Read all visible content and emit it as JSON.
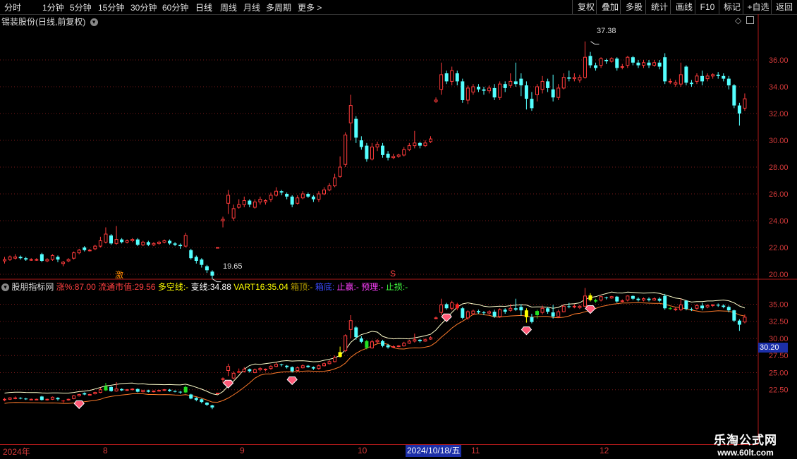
{
  "toolbar": {
    "periods": [
      "分时",
      "1分钟",
      "5分钟",
      "15分钟",
      "30分钟",
      "60分钟",
      "日线",
      "周线",
      "月线",
      "多周期",
      "更多 >"
    ],
    "active_period": "日线",
    "actions": [
      "复权",
      "叠加",
      "多股",
      "统计",
      "画线",
      "F10",
      "标记",
      "+自选",
      "返回"
    ]
  },
  "main_chart": {
    "title": "锡装股份(日线,前复权)",
    "y_ticks": [
      "36.00",
      "34.00",
      "32.00",
      "30.00",
      "28.00",
      "26.00",
      "24.00",
      "22.00",
      "20.00"
    ],
    "high_label": "37.38",
    "low_label": "19.65",
    "marker_ji": "激",
    "marker_s": "S"
  },
  "sub_chart": {
    "indicator_name": "股朋指标网",
    "zhangfu_label": "涨%:",
    "zhangfu_value": "87.00",
    "liutong_label": "流通市值:",
    "liutong_value": "29.56",
    "duokong_label": "多空线:",
    "duokong_value": "-",
    "bianxian_label": "变线:",
    "bianxian_value": "34.88",
    "vart_label": "VART16:",
    "vart_value": "35.04",
    "xiangding_label": "箱顶:",
    "xiangding_value": "-",
    "xiangdi_label": "箱底:",
    "xiangdi_value": "",
    "zhiying_label": "止赢:",
    "zhiying_value": "-",
    "yuli_label": "预理:",
    "yuli_value": "-",
    "zhisun_label": "止损:",
    "zhisun_value": "-",
    "y_ticks": [
      "35.00",
      "32.50",
      "30.00",
      "27.50",
      "25.00",
      "22.50"
    ],
    "current_price": "30.20"
  },
  "x_axis": {
    "labels": [
      "2024年",
      "8",
      "9",
      "10",
      "11",
      "12"
    ],
    "selected_date": "2024/10/18/五"
  },
  "watermark": {
    "title": "乐淘公式网",
    "url": "www.60lt.com"
  },
  "colors": {
    "up": "#ff3b3b",
    "down": "#54ffff",
    "ma_white": "#ffffcc",
    "ma_orange": "#ff7a2a",
    "grid": "#7a1a1a",
    "axis_text": "#d63a3a"
  },
  "chart_data": {
    "type": "candlestick",
    "price_axis_range": [
      19.2,
      37.6
    ],
    "candles": [
      [
        21.0,
        21.1,
        21.3,
        20.8
      ],
      [
        21.1,
        21.3,
        21.4,
        21.0
      ],
      [
        21.2,
        21.3,
        21.5,
        21.1
      ],
      [
        21.3,
        21.2,
        21.4,
        21.1
      ],
      [
        21.2,
        21.1,
        21.3,
        21.0
      ],
      [
        21.1,
        21.1,
        21.2,
        21.0
      ],
      [
        21.1,
        21.1,
        21.2,
        21.0
      ],
      [
        21.5,
        21.0,
        21.6,
        20.9
      ],
      [
        21.0,
        21.1,
        21.2,
        20.9
      ],
      [
        21.1,
        21.4,
        21.5,
        21.0
      ],
      [
        21.3,
        21.1,
        21.4,
        20.9
      ],
      [
        20.8,
        20.9,
        21.0,
        20.6
      ],
      [
        21.0,
        21.1,
        21.2,
        20.9
      ],
      [
        21.2,
        21.6,
        21.7,
        21.1
      ],
      [
        21.6,
        21.8,
        21.9,
        21.5
      ],
      [
        22.0,
        21.8,
        22.1,
        21.7
      ],
      [
        21.8,
        21.8,
        21.9,
        21.7
      ],
      [
        21.9,
        22.1,
        22.2,
        21.8
      ],
      [
        22.1,
        22.5,
        22.8,
        22.0
      ],
      [
        22.4,
        23.0,
        23.5,
        22.3
      ],
      [
        22.9,
        22.3,
        23.0,
        22.2
      ],
      [
        22.3,
        22.6,
        23.6,
        22.2
      ],
      [
        22.6,
        22.4,
        22.7,
        22.3
      ],
      [
        22.4,
        22.5,
        22.6,
        22.3
      ],
      [
        22.5,
        22.6,
        22.7,
        22.4
      ],
      [
        22.6,
        22.2,
        22.7,
        22.1
      ],
      [
        22.2,
        22.4,
        22.5,
        22.1
      ],
      [
        22.4,
        22.2,
        22.5,
        22.1
      ],
      [
        22.2,
        22.3,
        22.4,
        22.1
      ],
      [
        22.3,
        22.4,
        22.5,
        22.2
      ],
      [
        22.4,
        22.5,
        22.6,
        22.3
      ],
      [
        22.5,
        22.3,
        22.6,
        22.2
      ],
      [
        22.3,
        22.2,
        22.4,
        22.1
      ],
      [
        22.2,
        22.1,
        22.3,
        21.9
      ],
      [
        22.1,
        22.9,
        23.1,
        22.0
      ],
      [
        21.8,
        21.2,
        21.9,
        21.1
      ],
      [
        21.3,
        21.0,
        21.4,
        20.8
      ],
      [
        21.1,
        20.7,
        21.2,
        20.5
      ],
      [
        20.6,
        20.3,
        20.7,
        20.1
      ],
      [
        20.2,
        19.9,
        20.3,
        19.65
      ],
      [
        22.0,
        22.0,
        22.0,
        22.0
      ],
      [
        24.0,
        24.1,
        24.3,
        23.5
      ],
      [
        25.3,
        25.9,
        26.3,
        24.5
      ],
      [
        24.2,
        24.9,
        25.2,
        24.0
      ],
      [
        25.0,
        25.2,
        25.6,
        24.9
      ],
      [
        25.2,
        25.5,
        25.8,
        25.0
      ],
      [
        25.5,
        25.2,
        25.6,
        25.0
      ],
      [
        25.0,
        25.4,
        25.6,
        24.9
      ],
      [
        25.4,
        25.6,
        25.8,
        25.2
      ],
      [
        25.4,
        25.5,
        25.6,
        25.2
      ],
      [
        25.6,
        25.9,
        26.1,
        25.4
      ],
      [
        25.9,
        26.2,
        26.5,
        25.8
      ],
      [
        26.2,
        26.1,
        26.3,
        25.9
      ],
      [
        26.0,
        25.8,
        26.1,
        25.6
      ],
      [
        25.8,
        25.2,
        25.9,
        25.0
      ],
      [
        25.3,
        25.7,
        25.9,
        25.2
      ],
      [
        25.7,
        26.0,
        26.2,
        25.6
      ],
      [
        26.0,
        25.8,
        26.1,
        25.7
      ],
      [
        25.8,
        25.6,
        25.9,
        25.4
      ],
      [
        25.6,
        26.0,
        26.2,
        25.4
      ],
      [
        26.0,
        26.3,
        26.5,
        25.9
      ],
      [
        26.3,
        26.6,
        26.8,
        26.2
      ],
      [
        26.6,
        27.2,
        27.5,
        26.5
      ],
      [
        27.3,
        28.0,
        28.8,
        27.2
      ],
      [
        28.2,
        30.4,
        30.6,
        28.0
      ],
      [
        31.3,
        32.6,
        33.4,
        30.0
      ],
      [
        31.6,
        30.2,
        31.8,
        29.8
      ],
      [
        30.0,
        29.5,
        30.3,
        29.3
      ],
      [
        29.6,
        28.6,
        29.8,
        28.4
      ],
      [
        28.6,
        29.5,
        29.8,
        28.5
      ],
      [
        29.5,
        29.7,
        29.9,
        29.2
      ],
      [
        29.6,
        28.9,
        29.8,
        28.7
      ],
      [
        29.0,
        28.7,
        29.2,
        28.5
      ],
      [
        28.7,
        28.8,
        29.0,
        28.6
      ],
      [
        28.8,
        28.9,
        29.0,
        28.7
      ],
      [
        28.9,
        29.3,
        29.5,
        28.8
      ],
      [
        29.3,
        29.6,
        29.8,
        29.2
      ],
      [
        29.6,
        29.8,
        30.7,
        29.4
      ],
      [
        29.8,
        29.6,
        29.9,
        29.4
      ],
      [
        29.6,
        29.8,
        30.0,
        29.5
      ],
      [
        29.9,
        30.1,
        30.3,
        29.8
      ],
      [
        32.9,
        33.0,
        33.2,
        32.8
      ],
      [
        33.8,
        34.9,
        35.8,
        33.4
      ],
      [
        35.0,
        34.4,
        35.2,
        34.2
      ],
      [
        34.4,
        35.2,
        35.5,
        34.1
      ],
      [
        35.0,
        34.4,
        35.2,
        34.1
      ],
      [
        34.4,
        33.0,
        34.6,
        32.8
      ],
      [
        33.0,
        33.9,
        34.1,
        32.7
      ],
      [
        33.6,
        34.0,
        34.2,
        33.4
      ],
      [
        34.0,
        33.8,
        34.2,
        33.6
      ],
      [
        33.8,
        33.7,
        34.0,
        33.4
      ],
      [
        33.7,
        33.9,
        34.1,
        33.5
      ],
      [
        33.9,
        33.2,
        34.2,
        33.0
      ],
      [
        33.2,
        34.2,
        34.4,
        33.0
      ],
      [
        34.2,
        33.9,
        34.4,
        33.6
      ],
      [
        34.1,
        34.4,
        35.0,
        33.9
      ],
      [
        34.4,
        34.2,
        35.8,
        34.0
      ],
      [
        34.6,
        34.1,
        35.0,
        33.3
      ],
      [
        34.1,
        33.1,
        34.4,
        32.3
      ],
      [
        33.1,
        32.4,
        33.6,
        32.2
      ],
      [
        33.4,
        34.0,
        34.2,
        32.9
      ],
      [
        33.8,
        34.4,
        34.8,
        33.5
      ],
      [
        34.4,
        33.9,
        34.6,
        33.6
      ],
      [
        33.8,
        33.2,
        34.9,
        32.9
      ],
      [
        33.2,
        33.9,
        34.2,
        33.0
      ],
      [
        33.9,
        34.7,
        35.0,
        33.8
      ],
      [
        34.7,
        34.6,
        35.2,
        34.4
      ],
      [
        34.6,
        34.7,
        35.0,
        34.4
      ],
      [
        34.5,
        34.7,
        34.9,
        34.3
      ],
      [
        34.7,
        36.2,
        37.38,
        34.6
      ],
      [
        36.3,
        35.6,
        36.6,
        35.4
      ],
      [
        35.6,
        35.4,
        35.8,
        35.2
      ],
      [
        35.6,
        36.1,
        36.2,
        35.4
      ],
      [
        36.0,
        35.9,
        36.1,
        35.7
      ],
      [
        35.9,
        36.1,
        36.2,
        35.8
      ],
      [
        36.1,
        35.4,
        36.2,
        35.2
      ],
      [
        35.5,
        35.5,
        35.7,
        35.3
      ],
      [
        35.6,
        36.2,
        36.3,
        35.4
      ],
      [
        36.2,
        35.8,
        36.3,
        35.6
      ],
      [
        35.8,
        35.6,
        36.0,
        35.4
      ],
      [
        35.6,
        35.8,
        36.0,
        35.4
      ],
      [
        35.8,
        35.6,
        36.0,
        35.4
      ],
      [
        35.6,
        35.8,
        36.0,
        35.5
      ],
      [
        35.8,
        35.5,
        36.0,
        35.3
      ],
      [
        36.2,
        34.4,
        36.5,
        34.2
      ],
      [
        34.4,
        34.4,
        34.6,
        34.2
      ],
      [
        34.2,
        34.3,
        34.5,
        34.0
      ],
      [
        34.2,
        34.9,
        35.8,
        34.0
      ],
      [
        35.5,
        34.3,
        35.6,
        34.1
      ],
      [
        34.3,
        34.2,
        34.5,
        34.0
      ],
      [
        34.4,
        34.8,
        35.0,
        34.2
      ],
      [
        34.8,
        34.4,
        35.2,
        34.1
      ],
      [
        34.6,
        34.8,
        35.0,
        34.4
      ],
      [
        34.8,
        34.9,
        35.0,
        34.6
      ],
      [
        34.9,
        34.8,
        35.1,
        34.6
      ],
      [
        34.8,
        34.6,
        35.0,
        34.4
      ],
      [
        34.6,
        34.1,
        34.8,
        33.8
      ],
      [
        34.1,
        32.6,
        34.2,
        32.4
      ],
      [
        32.6,
        32.0,
        32.8,
        31.1
      ],
      [
        32.4,
        33.1,
        33.5,
        32.2
      ]
    ]
  }
}
